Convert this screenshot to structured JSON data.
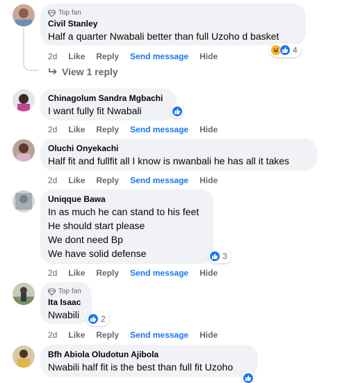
{
  "labels": {
    "top_fan": "Top fan",
    "like": "Like",
    "reply": "Reply",
    "send_message": "Send message",
    "hide": "Hide"
  },
  "comments": [
    {
      "author": "Civil Stanley",
      "top_fan": true,
      "text": "Half a quarter Nwabali better than full Uzoho d basket",
      "time": "2d",
      "reactions": [
        "haha",
        "like"
      ],
      "reaction_count": "4"
    },
    {
      "author": "Chinagolum Sandra Mgbachi",
      "top_fan": false,
      "text": "I want fully fit Nwabali",
      "time": "2d",
      "reactions": [
        "like"
      ],
      "reaction_count": ""
    },
    {
      "author": "Oluchi Onyekachi",
      "top_fan": false,
      "text": "Half fit and fullfit all I know is nwanbali he has all it takes",
      "time": "2d",
      "reactions": [],
      "reaction_count": ""
    },
    {
      "author": "Uniqque Bawa",
      "top_fan": false,
      "lines": [
        "In as much he can stand to his feet",
        "He should start please",
        "We dont need Bp",
        "We have solid defense"
      ],
      "time": "2d",
      "reactions": [
        "like"
      ],
      "reaction_count": "3"
    },
    {
      "author": "Ita Isaac",
      "top_fan": true,
      "text": "Nwabili",
      "time": "2d",
      "reactions": [
        "like"
      ],
      "reaction_count": "2"
    },
    {
      "author": "Bfh Abiola Oludotun Ajibola",
      "top_fan": false,
      "text": "Nwabili half fit is the best than full fit Uzoho",
      "time": "2d",
      "reactions": [
        "like"
      ],
      "reaction_count": ""
    }
  ],
  "view_replies": "View 1 reply",
  "colors": {
    "link": "#1877f2",
    "secondary_text": "#65676b",
    "bubble": "#f0f2f5"
  }
}
